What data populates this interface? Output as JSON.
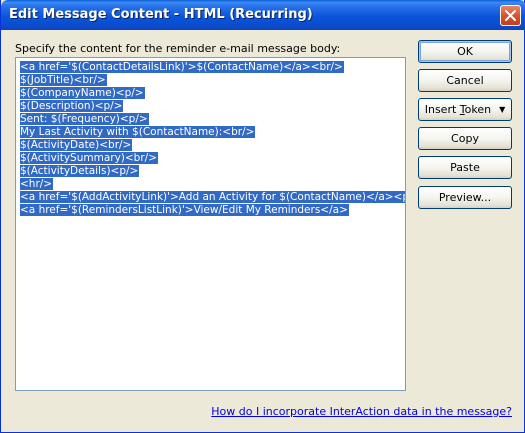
{
  "window": {
    "title": "Edit Message Content - HTML (Recurring)"
  },
  "prompt_label": "Specify the content for the reminder e-mail message body:",
  "editor": {
    "lines": [
      "<a href='$(ContactDetailsLink)'>$(ContactName)</a><br/>",
      "$(JobTitle)<br/>",
      "$(CompanyName)<p/>",
      "$(Description)<p/>",
      "Sent: $(Frequency)<p/>",
      "My Last Activity with $(ContactName):<br/>",
      "$(ActivityDate)<br/>",
      "$(ActivitySummary)<br/>",
      "$(ActivityDetails)<p/>",
      "<hr/>",
      "<a href='$(AddActivityLink)'>Add an Activity for $(ContactName)</a><p/>",
      "<a href='$(RemindersListLink)'>View/Edit My Reminders</a>"
    ],
    "selection_color": "#316ac5"
  },
  "buttons": {
    "ok": "OK",
    "cancel": "Cancel",
    "insert_token_prefix": "Insert ",
    "insert_token_mnemonic": "T",
    "insert_token_suffix": "oken",
    "copy": "Copy",
    "paste": "Paste",
    "preview": "Preview..."
  },
  "help_link": "How do I incorporate InterAction data in the message?",
  "colors": {
    "titlebar": "#0b55d9",
    "dialog_bg": "#ece9d8",
    "link": "#0000ee"
  }
}
